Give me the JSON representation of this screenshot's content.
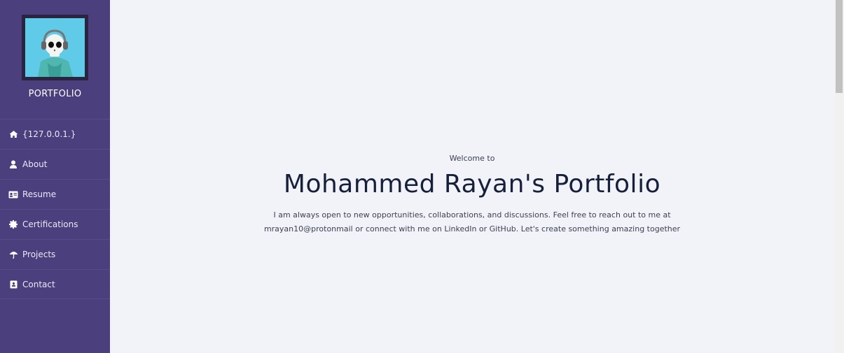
{
  "sidebar": {
    "brand": "PORTFOLIO",
    "items": [
      {
        "label": "{127.0.0.1.}",
        "icon": "home-icon"
      },
      {
        "label": "About",
        "icon": "user-icon"
      },
      {
        "label": "Resume",
        "icon": "id-card-icon"
      },
      {
        "label": "Certifications",
        "icon": "certificate-icon"
      },
      {
        "label": "Projects",
        "icon": "umbrella-icon"
      },
      {
        "label": "Contact",
        "icon": "address-book-icon"
      }
    ],
    "colors": {
      "background": "#4b3f7d",
      "text": "#ffffff"
    }
  },
  "main": {
    "welcome": "Welcome to",
    "title": "Mohammed Rayan's Portfolio",
    "text": "I am always open to new opportunities, collaborations, and discussions. Feel free to reach out to me at mrayan10@protonmail or connect with me on LinkedIn or GitHub. Let's create something amazing together"
  }
}
